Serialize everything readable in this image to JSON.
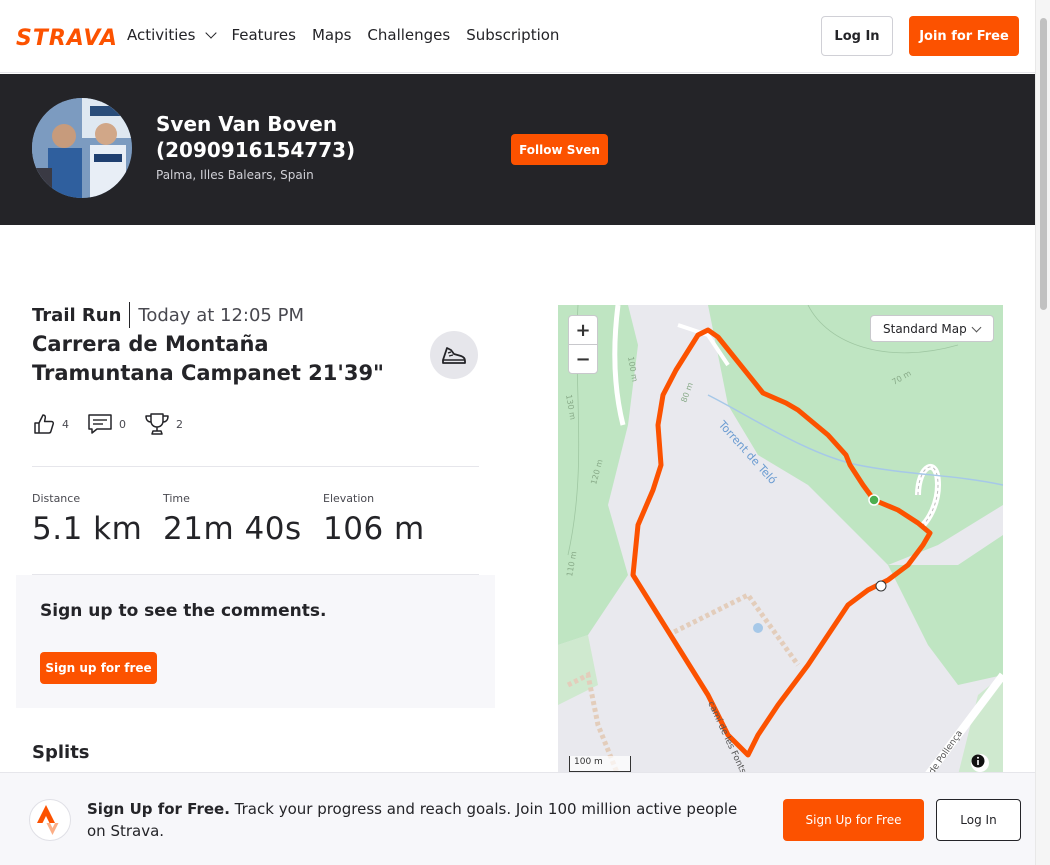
{
  "nav": {
    "logo": "STRAVA",
    "links": [
      "Activities",
      "Features",
      "Maps",
      "Challenges",
      "Subscription"
    ],
    "login": "Log In",
    "join": "Join for Free",
    "brand_color": "#fc5200"
  },
  "athlete": {
    "name": "Sven Van Boven (2090916154773)",
    "location": "Palma, Illes Balears, Spain",
    "follow": "Follow Sven"
  },
  "activity": {
    "type": "Trail Run",
    "date": "Today at 12:05 PM",
    "title": "Carrera de Montaña Tramuntana Campanet 21'39\"",
    "sport_icon": "running-shoe-icon",
    "kudos": "4",
    "comments": "0",
    "achievements": "2",
    "stats": {
      "distance_label": "Distance",
      "distance": "5.1 km",
      "time_label": "Time",
      "time": "21m 40s",
      "elevation_label": "Elevation",
      "elevation": "106 m"
    }
  },
  "comments_box": {
    "title": "Sign up to see the comments.",
    "button": "Sign up for free"
  },
  "splits": {
    "title": "Splits"
  },
  "map": {
    "zoom_in": "+",
    "zoom_out": "−",
    "map_type": "Standard Map",
    "scale": "100 m",
    "labels": {
      "stream": "Torrent de Teló",
      "road": "camí de les Fonts",
      "road2": "de Pollença",
      "c1": "100 m",
      "c2": "80 m",
      "c3": "70 m",
      "c4": "120 m",
      "c5": "110 m",
      "c6": "130 m"
    }
  },
  "banner": {
    "bold": "Sign Up for Free.",
    "text": " Track your progress and reach goals. Join 100 million active people on Strava.",
    "signup": "Sign Up for Free",
    "login": "Log In"
  }
}
